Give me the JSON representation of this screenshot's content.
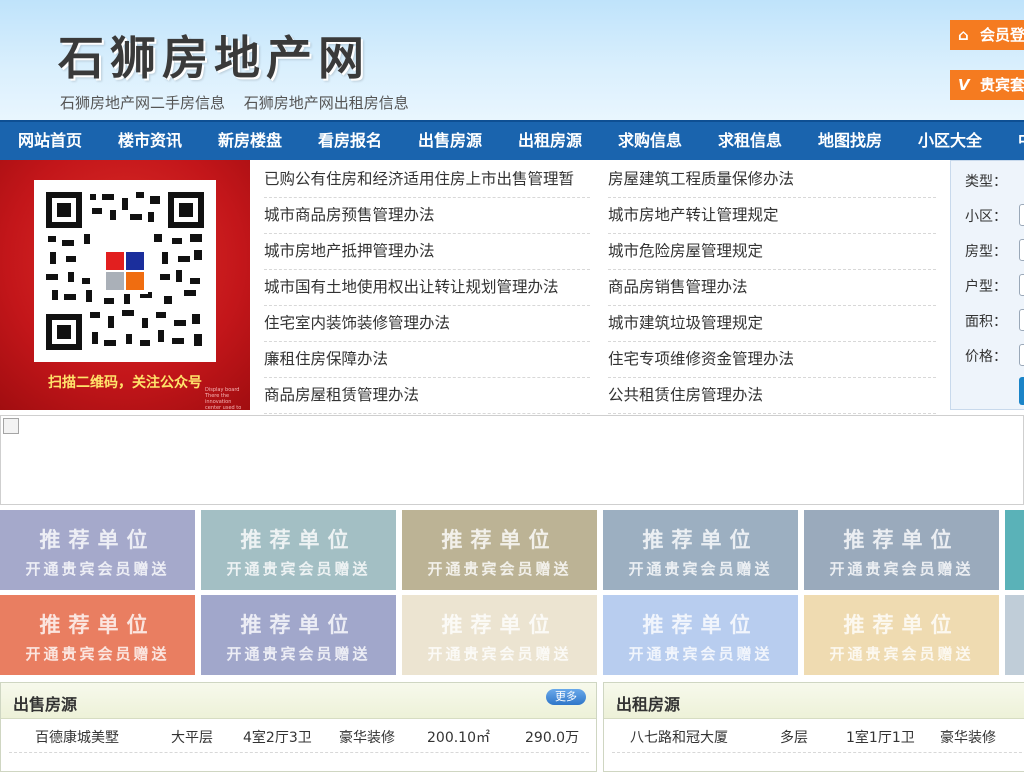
{
  "site": {
    "logo": "石狮房地产网",
    "sublinks": [
      "石狮房地产网二手房信息",
      "石狮房地产网出租房信息"
    ],
    "member_login": "会员登",
    "vip": "贵宾套"
  },
  "nav": [
    "网站首页",
    "楼市资讯",
    "新房楼盘",
    "看房报名",
    "出售房源",
    "出租房源",
    "求购信息",
    "求租信息",
    "地图找房",
    "小区大全",
    "中"
  ],
  "banner": {
    "caption": "扫描二维码，关注公众号",
    "small_text": "Display board There the innovation center used to the"
  },
  "news_left": [
    "已购公有住房和经济适用住房上市出售管理暂",
    "城市商品房预售管理办法",
    "城市房地产抵押管理办法",
    "城市国有土地使用权出让转让规划管理办法",
    "住宅室内装饰装修管理办法",
    "廉租住房保障办法",
    "商品房屋租赁管理办法"
  ],
  "news_right": [
    "房屋建筑工程质量保修办法",
    "城市房地产转让管理规定",
    "城市危险房屋管理规定",
    "商品房销售管理办法",
    "城市建筑垃圾管理规定",
    "住宅专项维修资金管理办法",
    "公共租赁住房管理办法"
  ],
  "search": {
    "labels": [
      "类型：",
      "小区：",
      "房型：",
      "户型：",
      "面积：",
      "价格："
    ]
  },
  "promo": {
    "line1": "推荐单位",
    "line2": "开通贵宾会员赠送",
    "colors_row1": [
      "#a5a9cb",
      "#a3bfc4",
      "#bcb395",
      "#9cafc1",
      "#9aaabc",
      "#5ab2b8"
    ],
    "colors_row2": [
      "#e97e61",
      "#a1a7cb",
      "#ece4d1",
      "#b8cdef",
      "#efdbb1",
      "#c0cdd8"
    ]
  },
  "sale": {
    "title": "出售房源",
    "more": "更多",
    "rows": [
      {
        "name": "百德康城美墅",
        "floor": "大平层",
        "layout": "4室2厅3卫",
        "deco": "豪华装修",
        "area": "200.10㎡",
        "price": "290.0万"
      }
    ]
  },
  "rent": {
    "title": "出租房源",
    "rows": [
      {
        "name": "八七路和冠大厦",
        "floor": "多层",
        "layout": "1室1厅1卫",
        "deco": "豪华装修"
      }
    ]
  }
}
